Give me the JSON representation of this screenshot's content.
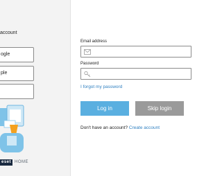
{
  "left": {
    "heading": "account",
    "social": [
      {
        "label": "ogle"
      },
      {
        "label": "ple"
      },
      {
        "label": ""
      }
    ],
    "logo": {
      "badge": "eset",
      "suffix": "HOME"
    }
  },
  "form": {
    "email_label": "Email address",
    "email_value": "",
    "password_label": "Password",
    "password_value": "",
    "forgot_link": "I forgot my password",
    "login_button": "Log in",
    "skip_button": "Skip login",
    "no_account_text": "Don't have an account?",
    "create_link": "Create account"
  },
  "icons": {
    "email": "mail-icon",
    "password": "key-icon"
  },
  "colors": {
    "primary": "#5aafe0",
    "secondary": "#9a9a9a",
    "link": "#2e7fc0",
    "brand_dark": "#1a2a40"
  }
}
